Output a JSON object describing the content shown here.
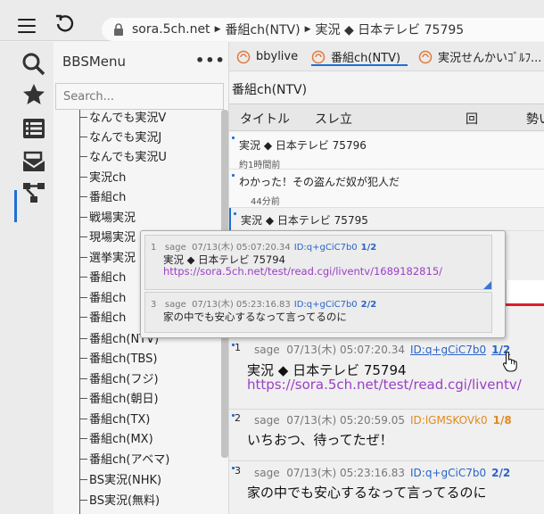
{
  "toolbar": {
    "url_host": "sora.5ch.net",
    "url_path": [
      "番組ch(NTV)",
      "実況 ◆ 日本テレビ 75795"
    ]
  },
  "colors": {
    "accent": "#1f6fd6",
    "id_blue": "#2a63c7",
    "id_orange": "#e08a20",
    "link": "#9a3fc4",
    "red_line": "#d9202c"
  },
  "activity_icons": [
    "search-icon",
    "favorites-star-icon",
    "list-icon",
    "mail-inbox-icon",
    "network-tree-icon"
  ],
  "sidebar": {
    "title": "BBSMenu",
    "more": "•••",
    "search_placeholder": "Search...",
    "items": [
      "なんでも実況V",
      "なんでも実況J",
      "なんでも実況U",
      "実況ch",
      "番組ch",
      "戦場実況",
      "現場実況",
      "選挙実況",
      "番組ch",
      "番組ch",
      "番組ch",
      "番組ch(NTV)",
      "番組ch(TBS)",
      "番組ch(フジ)",
      "番組ch(朝日)",
      "番組ch(TX)",
      "番組ch(MX)",
      "番組ch(アベマ)",
      "BS実況(NHK)",
      "BS実況(無料)"
    ]
  },
  "tabs": [
    {
      "label": "bbylive"
    },
    {
      "label": "番組ch(NTV)"
    },
    {
      "label": "実況せんかいｺﾞﾙﾌ..."
    }
  ],
  "board": {
    "title": "番組ch(NTV)",
    "columns": [
      "タイトル",
      "スレ立",
      "回",
      "勢い"
    ]
  },
  "threads": [
    {
      "title": "実況 ◆ 日本テレビ 75796",
      "meta": "約1時間前"
    },
    {
      "title": "わかった！その盗んだ奴が犯人だ",
      "meta": "44分前"
    },
    {
      "title": "実況 ◆ 日本テレビ 75795",
      "meta": ""
    }
  ],
  "popup": {
    "posts": [
      {
        "num": "1",
        "name": "sage",
        "date": "07/13(木) 05:07:20.34",
        "id": "ID:q+gCiC7b0",
        "count": "1/2",
        "text": "実況 ◆ 日本テレビ 75794",
        "link": "https://sora.5ch.net/test/read.cgi/liventv/1689182815/"
      },
      {
        "num": "3",
        "name": "sage",
        "date": "07/13(木) 05:23:16.83",
        "id": "ID:q+gCiC7b0",
        "count": "2/2",
        "text": "家の中でも安心するなって言ってるのに",
        "link": ""
      }
    ]
  },
  "posts": [
    {
      "num": "1",
      "name": "sage",
      "date": "07/13(木) 05:07:20.34",
      "id": "ID:q+gCiC7b0",
      "count": "1/2",
      "text": "実況 ◆ 日本テレビ 75794",
      "link": "https://sora.5ch.net/test/read.cgi/liventv/"
    },
    {
      "num": "2",
      "name": "sage",
      "date": "07/13(木) 05:20:59.05",
      "id": "ID:lGMSKOVk0",
      "count": "1/8",
      "text": "いちおつ、待ってたぜ！",
      "link": ""
    },
    {
      "num": "3",
      "name": "sage",
      "date": "07/13(木) 05:23:16.83",
      "id": "ID:q+gCiC7b0",
      "count": "2/2",
      "text": "家の中でも安心するなって言ってるのに",
      "link": ""
    }
  ]
}
